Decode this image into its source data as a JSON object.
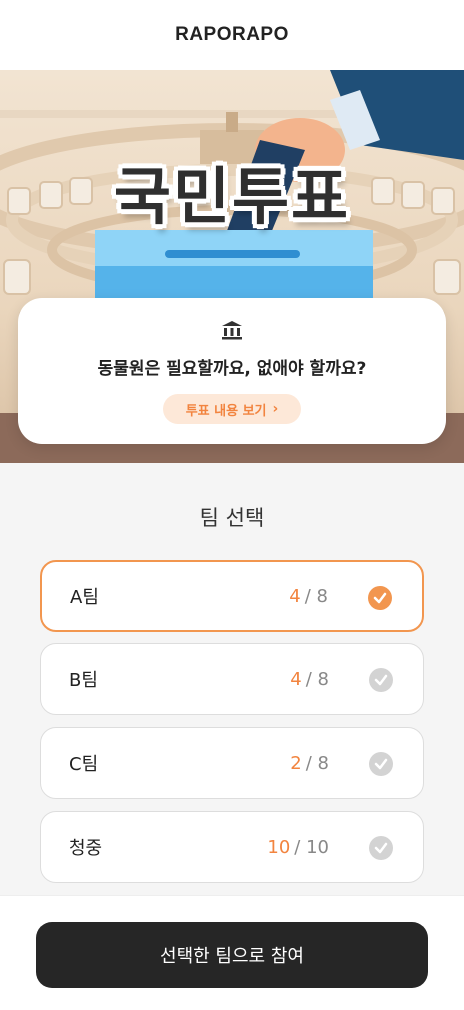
{
  "app": {
    "logo": "RAPORAPO"
  },
  "hero": {
    "title": "국민투표"
  },
  "topic": {
    "icon": "bank-icon",
    "question": "동물원은 필요할까요, 없애야 할까요?",
    "detail_label": "투표 내용 보기"
  },
  "team_section": {
    "title": "팀 선택"
  },
  "teams": [
    {
      "name": "A팀",
      "current": "4",
      "total": "/ 8",
      "selected": true
    },
    {
      "name": "B팀",
      "current": "4",
      "total": "/ 8",
      "selected": false
    },
    {
      "name": "C팀",
      "current": "2",
      "total": "/ 8",
      "selected": false
    },
    {
      "name": "청중",
      "current": "10",
      "total": "/ 10",
      "selected": false
    }
  ],
  "action": {
    "join_label": "선택한 팀으로 참여"
  },
  "colors": {
    "accent": "#f2964f",
    "dark_button": "#262626",
    "check_inactive": "#d3d3d3"
  }
}
